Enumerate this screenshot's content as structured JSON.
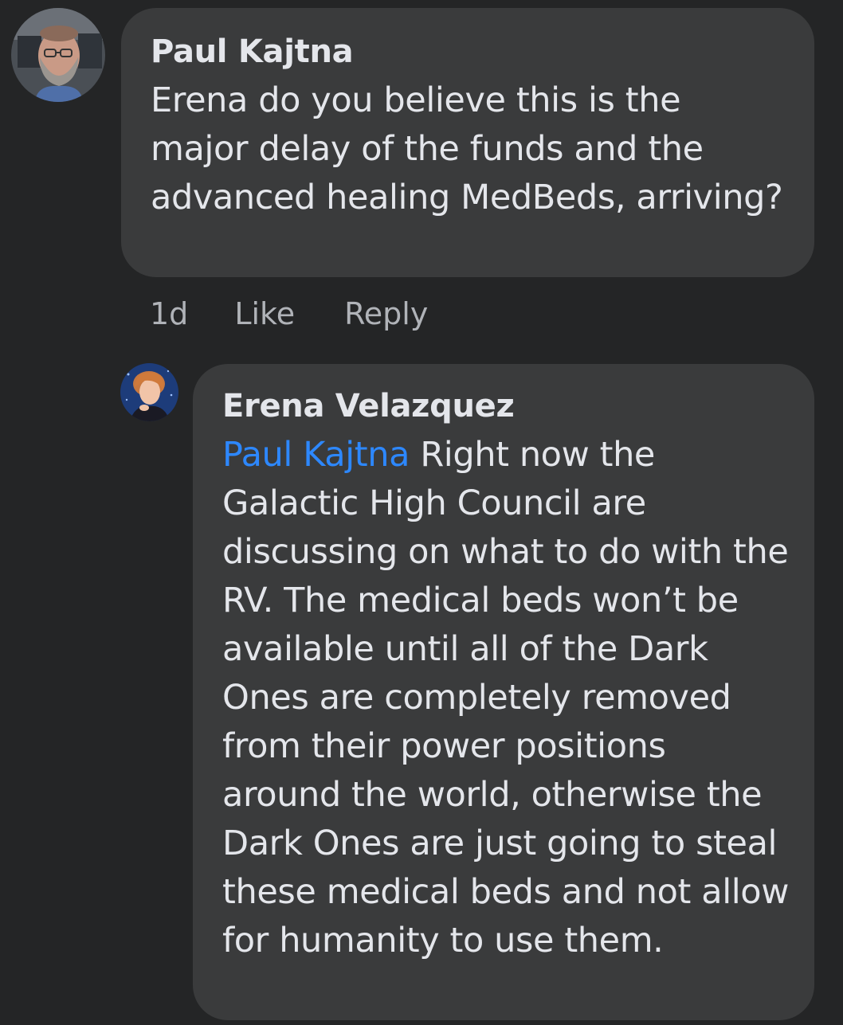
{
  "colors": {
    "background": "#242526",
    "bubble": "#3a3b3c",
    "text_primary": "#e4e6eb",
    "text_secondary": "#b0b3b8",
    "mention": "#2d88ff"
  },
  "comment": {
    "author": "Paul Kajtna",
    "text": "Erena do you believe this is the major delay of the funds  and the advanced healing MedBeds, arriving?",
    "avatar_icon": "user-avatar-photo",
    "actions": {
      "time": "1d",
      "like": "Like",
      "reply": "Reply"
    }
  },
  "reply": {
    "author": "Erena Velazquez",
    "mention": "Paul Kajtna",
    "text": "Right now the Galactic High Council are discussing on what to do with the RV. The medical beds won’t be available until all of the Dark Ones are completely removed from their power positions around the world, otherwise the Dark Ones are just going to steal these medical beds and not allow for humanity to use them.",
    "avatar_icon": "user-avatar-photo"
  }
}
